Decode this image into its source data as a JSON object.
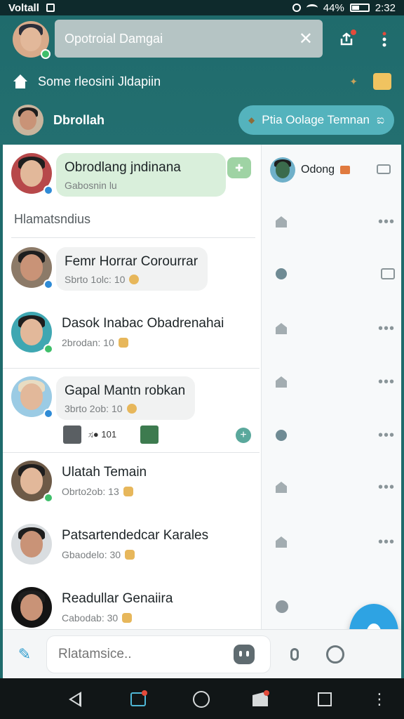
{
  "status_bar": {
    "carrier": "Voltall",
    "battery": "44%",
    "time": "2:32"
  },
  "header": {
    "search_text": "Opotroial Damgai",
    "close_symbol": "✕",
    "group_row": {
      "label": "Some rleosini Jldapiin"
    },
    "user_row": {
      "name": "Dbrollah",
      "invite_label": "Ptia Oolage Temnan",
      "invite_suffix": "ಐ"
    }
  },
  "chats": {
    "pinned": {
      "name": "Obrodlang jndinana",
      "meta": "Gabosnin lu"
    },
    "section_label": "Hlamatsndius",
    "items": [
      {
        "name": "Femr Horrar Corourrar",
        "meta": "Sbrto 1olc: 10"
      },
      {
        "name": "Dasok Inabac Obadrenahai",
        "meta": "2brodan: 10"
      },
      {
        "name": "Gapal Mantn robkan",
        "meta": "3brto 2ob: 10"
      },
      {
        "name": "Ulatah Temain",
        "meta": "Obrto2ob: 13"
      },
      {
        "name": "Patsartendedcar Karales",
        "meta": "Gbaodelo: 30"
      },
      {
        "name": "Readullar Genaiira",
        "meta": "Cabodab: 30"
      }
    ],
    "reactions_text": "ಸ● 101"
  },
  "right_panel": {
    "header_name": "Odong"
  },
  "composer": {
    "placeholder": "Rlatamsice.."
  },
  "icons": {
    "plus": "+",
    "pen": "✎",
    "dots": "•••",
    "vdots": "⋮"
  },
  "colors": {
    "header_teal": "#1f6b6c",
    "accent_blue": "#2ea3e3",
    "invite_pill": "#54b3bd",
    "pinned_bubble": "#d9efdb"
  }
}
